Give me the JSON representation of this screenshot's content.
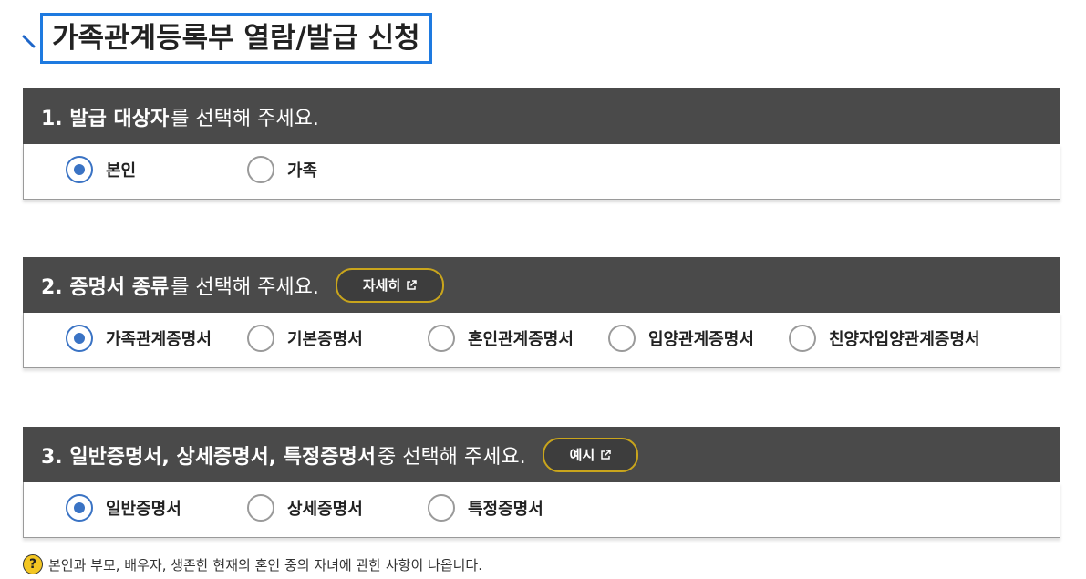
{
  "page": {
    "title": "가족관계등록부 열람/발급 신청"
  },
  "sections": [
    {
      "header_strong": "1. 발급 대상자",
      "header_rest": "를 선택해 주세요.",
      "options": [
        {
          "label": "본인",
          "checked": true
        },
        {
          "label": "가족",
          "checked": false
        }
      ]
    },
    {
      "header_strong": "2. 증명서 종류",
      "header_rest": "를 선택해 주세요.",
      "button": "자세히",
      "options": [
        {
          "label": "가족관계증명서",
          "checked": true
        },
        {
          "label": "기본증명서",
          "checked": false
        },
        {
          "label": "혼인관계증명서",
          "checked": false
        },
        {
          "label": "입양관계증명서",
          "checked": false
        },
        {
          "label": "친양자입양관계증명서",
          "checked": false
        }
      ]
    },
    {
      "header_strong": "3. 일반증명서, 상세증명서, 특정증명서",
      "header_rest": " 중 선택해 주세요.",
      "button": "예시",
      "options": [
        {
          "label": "일반증명서",
          "checked": true
        },
        {
          "label": "상세증명서",
          "checked": false
        },
        {
          "label": "특정증명서",
          "checked": false
        }
      ]
    }
  ],
  "note": {
    "icon": "?",
    "text": "본인과 부모, 배우자, 생존한 현재의 혼인 중의 자녀에 관한 사항이 나옵니다."
  }
}
